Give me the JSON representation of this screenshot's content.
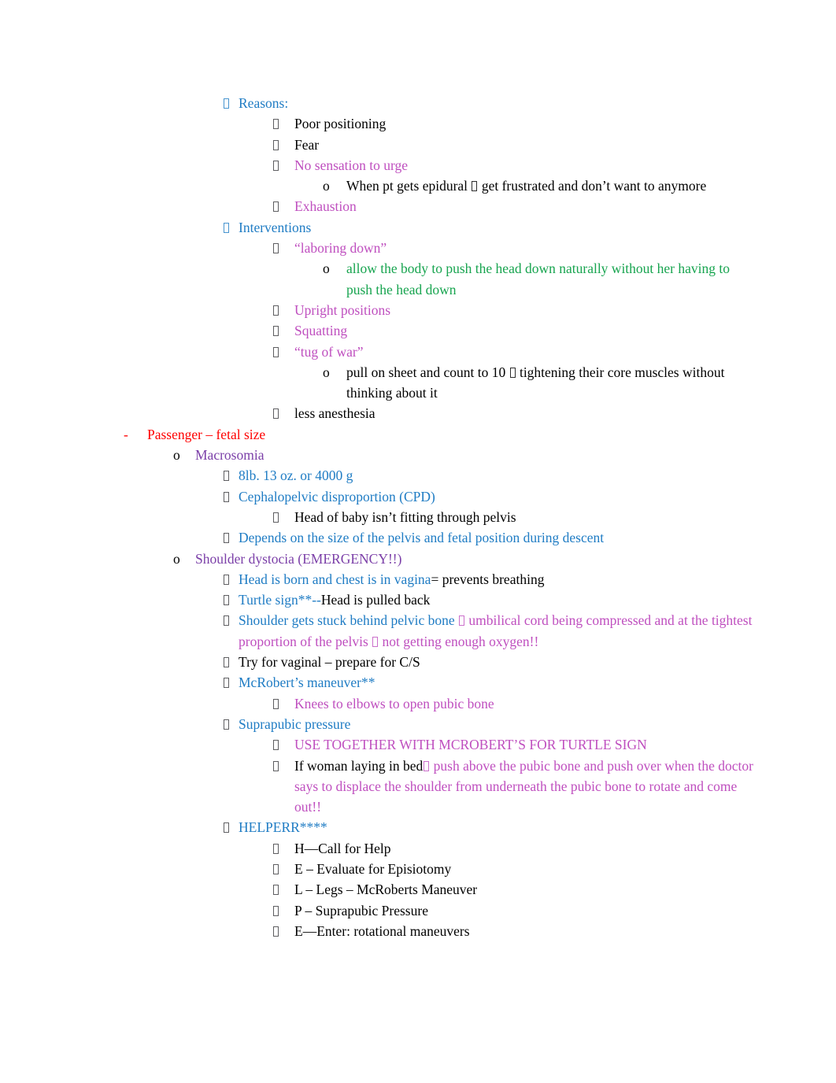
{
  "document": {
    "title": "Labor & Delivery Notes — Pushing Interventions and Passenger / Fetal Size",
    "page_background": "#ffffff",
    "colors": {
      "black": "#000000",
      "blue": "#1F7CC4",
      "magenta": "#BF4FBF",
      "green": "#17A44F",
      "purple": "#7B3FA8",
      "red": "#FF0000",
      "bullet_gray": "#58585C"
    },
    "markers": {
      "dash": "-",
      "circle": "o",
      "tofu": "□"
    }
  },
  "outline": [
    {
      "id": "reasons",
      "level": 3,
      "marker": "tofu",
      "marker_color": "blue",
      "segments": [
        {
          "text": "Reasons:",
          "color": "blue"
        }
      ]
    },
    {
      "id": "poor-positioning",
      "level": 4,
      "marker": "tofu",
      "marker_color": "gray",
      "segments": [
        {
          "text": "Poor positioning",
          "color": "black"
        }
      ]
    },
    {
      "id": "fear",
      "level": 4,
      "marker": "tofu",
      "marker_color": "gray",
      "segments": [
        {
          "text": "Fear",
          "color": "black"
        }
      ]
    },
    {
      "id": "no-sensation-to-urge",
      "level": 4,
      "marker": "tofu",
      "marker_color": "gray",
      "segments": [
        {
          "text": "No sensation to urge",
          "color": "magenta"
        }
      ]
    },
    {
      "id": "epidural-frustrated",
      "level": 5,
      "marker": "circle",
      "marker_color": "black",
      "segments": [
        {
          "text": "When pt gets epidural ",
          "color": "black"
        },
        {
          "text": "□",
          "color": "black",
          "glyph": "tofu"
        },
        {
          "text": " get frustrated and don’t want to anymore",
          "color": "black"
        }
      ]
    },
    {
      "id": "exhaustion",
      "level": 4,
      "marker": "tofu",
      "marker_color": "gray",
      "segments": [
        {
          "text": "Exhaustion",
          "color": "magenta"
        }
      ]
    },
    {
      "id": "interventions",
      "level": 3,
      "marker": "tofu",
      "marker_color": "blue",
      "segments": [
        {
          "text": "Interventions",
          "color": "blue"
        }
      ]
    },
    {
      "id": "laboring-down",
      "level": 4,
      "marker": "tofu",
      "marker_color": "gray",
      "segments": [
        {
          "text": "“laboring down”",
          "color": "magenta"
        }
      ]
    },
    {
      "id": "allow-body-push",
      "level": 5,
      "marker": "circle",
      "marker_color": "black",
      "segments": [
        {
          "text": "allow the body to push the head down naturally without her having to push the head down",
          "color": "green"
        }
      ]
    },
    {
      "id": "upright-positions",
      "level": 4,
      "marker": "tofu",
      "marker_color": "gray",
      "segments": [
        {
          "text": "Upright positions",
          "color": "magenta"
        }
      ]
    },
    {
      "id": "squatting",
      "level": 4,
      "marker": "tofu",
      "marker_color": "gray",
      "segments": [
        {
          "text": "Squatting",
          "color": "magenta"
        }
      ]
    },
    {
      "id": "tug-of-war",
      "level": 4,
      "marker": "tofu",
      "marker_color": "gray",
      "segments": [
        {
          "text": "“tug of war”",
          "color": "magenta"
        }
      ]
    },
    {
      "id": "pull-on-sheet",
      "level": 5,
      "marker": "circle",
      "marker_color": "black",
      "segments": [
        {
          "text": "pull on sheet and count to 10  ",
          "color": "black"
        },
        {
          "text": "□",
          "color": "black",
          "glyph": "tofu"
        },
        {
          "text": " tightening their core muscles without thinking about it",
          "color": "black"
        }
      ]
    },
    {
      "id": "less-anesthesia",
      "level": 4,
      "marker": "tofu",
      "marker_color": "gray",
      "segments": [
        {
          "text": "less anesthesia",
          "color": "black"
        }
      ]
    },
    {
      "id": "passenger-fetal-size",
      "level": 1,
      "marker": "dash",
      "marker_color": "red",
      "segments": [
        {
          "text": "Passenger – fetal size",
          "color": "red"
        }
      ]
    },
    {
      "id": "macrosomia",
      "level": 2,
      "marker": "circle",
      "marker_color": "black",
      "segments": [
        {
          "text": "Macrosomia",
          "color": "purple"
        }
      ]
    },
    {
      "id": "weight-8lb-13oz",
      "level": 3,
      "marker": "tofu",
      "marker_color": "gray",
      "segments": [
        {
          "text": "8lb. 13 oz. or 4000 g",
          "color": "blue"
        }
      ]
    },
    {
      "id": "cpd",
      "level": 3,
      "marker": "tofu",
      "marker_color": "gray",
      "segments": [
        {
          "text": "Cephalopelvic disproportion (CPD)",
          "color": "blue"
        }
      ]
    },
    {
      "id": "head-not-fitting",
      "level": 4,
      "marker": "tofu",
      "marker_color": "gray",
      "segments": [
        {
          "text": "Head of baby isn’t fitting through pelvis",
          "color": "black"
        }
      ]
    },
    {
      "id": "depends-on-pelvis-size",
      "level": 3,
      "marker": "tofu",
      "marker_color": "gray",
      "segments": [
        {
          "text": "Depends on the size of the pelvis and fetal position during descent",
          "color": "blue"
        }
      ]
    },
    {
      "id": "shoulder-dystocia",
      "level": 2,
      "marker": "circle",
      "marker_color": "black",
      "segments": [
        {
          "text": "Shoulder dystocia (EMERGENCY!!)",
          "color": "purple"
        }
      ]
    },
    {
      "id": "head-born-chest-in-vagina",
      "level": 3,
      "marker": "tofu",
      "marker_color": "gray",
      "segments": [
        {
          "text": "Head is born and chest is in vagina",
          "color": "blue"
        },
        {
          "text": "= prevents breathing",
          "color": "black"
        }
      ]
    },
    {
      "id": "turtle-sign",
      "level": 3,
      "marker": "tofu",
      "marker_color": "gray",
      "segments": [
        {
          "text": "Turtle sign**--",
          "color": "blue"
        },
        {
          "text": "Head is pulled back",
          "color": "black"
        }
      ]
    },
    {
      "id": "shoulder-stuck",
      "level": 3,
      "marker": "tofu",
      "marker_color": "gray",
      "segments": [
        {
          "text": "Shoulder gets stuck behind pelvic bone ",
          "color": "blue"
        },
        {
          "text": "□",
          "color": "magenta",
          "glyph": "tofu"
        },
        {
          "text": " umbilical cord being compressed and at the tightest proportion of the pelvis  ",
          "color": "magenta"
        },
        {
          "text": "□",
          "color": "magenta",
          "glyph": "tofu"
        },
        {
          "text": " not getting enough oxygen!!",
          "color": "magenta"
        }
      ]
    },
    {
      "id": "try-vaginal-prepare-cs",
      "level": 3,
      "marker": "tofu",
      "marker_color": "gray",
      "segments": [
        {
          "text": "Try for vaginal – prepare for C/S",
          "color": "black"
        }
      ]
    },
    {
      "id": "mcroberts-maneuver",
      "level": 3,
      "marker": "tofu",
      "marker_color": "gray",
      "segments": [
        {
          "text": "McRobert’s maneuver**",
          "color": "blue"
        }
      ]
    },
    {
      "id": "knees-to-elbows",
      "level": 4,
      "marker": "tofu",
      "marker_color": "gray",
      "segments": [
        {
          "text": "Knees to elbows to open pubic bone",
          "color": "magenta"
        }
      ]
    },
    {
      "id": "suprapubic-pressure",
      "level": 3,
      "marker": "tofu",
      "marker_color": "gray",
      "segments": [
        {
          "text": "Suprapubic pressure",
          "color": "blue"
        }
      ]
    },
    {
      "id": "use-together-mcroberts",
      "level": 4,
      "marker": "tofu",
      "marker_color": "gray",
      "segments": [
        {
          "text": "USE TOGETHER WITH MCROBERT’S FOR TURTLE SIGN",
          "color": "magenta"
        }
      ]
    },
    {
      "id": "if-woman-laying-in-bed",
      "level": 4,
      "marker": "tofu",
      "marker_color": "gray",
      "segments": [
        {
          "text": "If woman laying in bed",
          "color": "black"
        },
        {
          "text": "□",
          "color": "magenta",
          "glyph": "tofu"
        },
        {
          "text": " push above the pubic bone and push over when the doctor says to displace the shoulder from underneath the pubic bone to rotate and come out!!",
          "color": "magenta"
        }
      ]
    },
    {
      "id": "helperr",
      "level": 3,
      "marker": "tofu",
      "marker_color": "gray",
      "segments": [
        {
          "text": "HELPERR****",
          "color": "blue"
        }
      ]
    },
    {
      "id": "helperr-h",
      "level": 4,
      "marker": "tofu",
      "marker_color": "gray",
      "segments": [
        {
          "text": "H—Call for Help",
          "color": "black"
        }
      ]
    },
    {
      "id": "helperr-e1",
      "level": 4,
      "marker": "tofu",
      "marker_color": "gray",
      "segments": [
        {
          "text": "E – Evaluate for Episiotomy",
          "color": "black"
        }
      ]
    },
    {
      "id": "helperr-l",
      "level": 4,
      "marker": "tofu",
      "marker_color": "gray",
      "segments": [
        {
          "text": "L – Legs – McRoberts Maneuver",
          "color": "black"
        }
      ]
    },
    {
      "id": "helperr-p",
      "level": 4,
      "marker": "tofu",
      "marker_color": "gray",
      "segments": [
        {
          "text": "P – Suprapubic Pressure",
          "color": "black"
        }
      ]
    },
    {
      "id": "helperr-e2",
      "level": 4,
      "marker": "tofu",
      "marker_color": "gray",
      "segments": [
        {
          "text": "E—Enter: rotational maneuvers",
          "color": "black"
        }
      ]
    }
  ]
}
